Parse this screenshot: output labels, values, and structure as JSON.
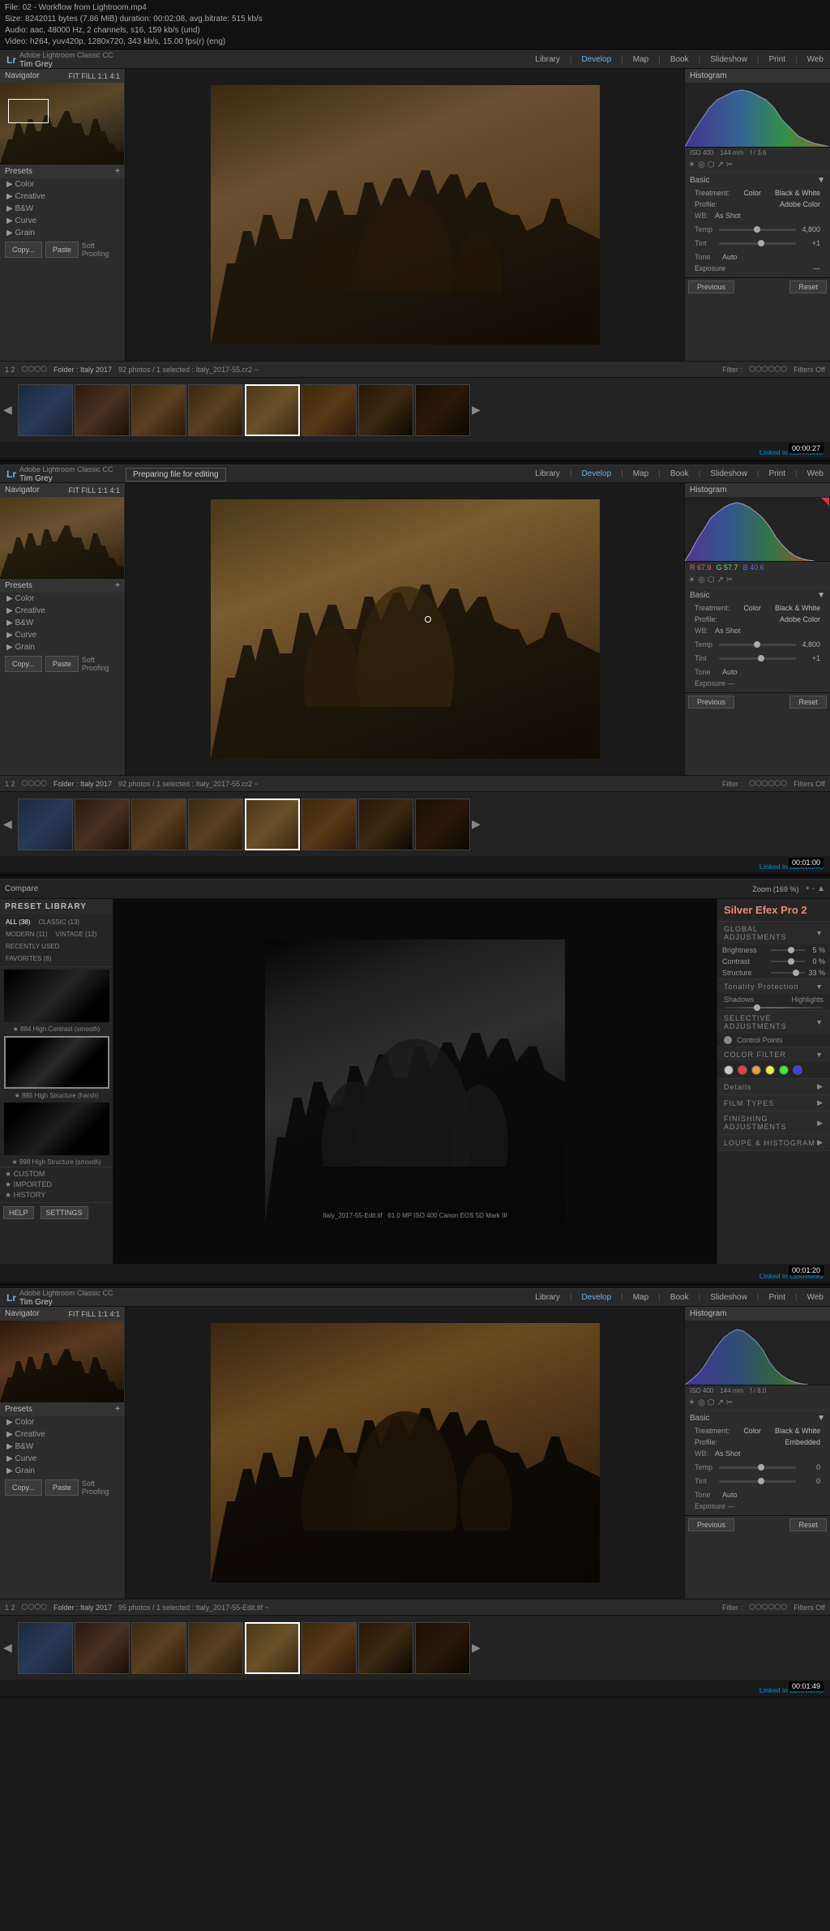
{
  "video": {
    "filename": "File: 02 - Workflow from Lightroom.mp4",
    "size": "Size: 8242011 bytes (7.86 MiB)  duration: 00:02:08, avg.bitrate: 515 kb/s",
    "audio": "Audio: aac, 48000 Hz, 2 channels, s16, 159 kb/s (und)",
    "video_codec": "Video: h264, yuv420p, 1280x720, 343 kb/s, 15.00 fps(r) (eng)"
  },
  "panel1": {
    "brand": "Adobe Lightroom Classic CC",
    "user": "Tim Grey",
    "logo": "Lr",
    "nav": {
      "library": "Library",
      "develop": "Develop",
      "map": "Map",
      "book": "Book",
      "slideshow": "Slideshow",
      "print": "Print",
      "web": "Web"
    },
    "navigator": {
      "title": "Navigator",
      "controls": "FIT  FILL  1:1  4:1"
    },
    "presets": {
      "title": "Presets",
      "items": [
        "▶ Color",
        "▶ Creative",
        "▶ B&W",
        "▶ Curve",
        "▶ Grain"
      ]
    },
    "histogram_label": "Histogram",
    "basic_label": "Basic",
    "treatment_label": "Treatment:",
    "treatment_color": "Color",
    "treatment_bw": "Black & White",
    "profile_label": "Profile:",
    "profile_value": "Adobe Color",
    "wb_label": "WB:",
    "wb_value": "As Shot",
    "temp_label": "Temp",
    "temp_value": "4,800",
    "tint_label": "Tint",
    "tint_value": "+1",
    "tone_label": "Tone",
    "tone_value": "Auto",
    "previous_btn": "Previous",
    "reset_btn": "Reset",
    "copy_btn": "Copy...",
    "paste_btn": "Paste",
    "softproof": "Soft Proofing",
    "folder": "Folder : Italy 2017",
    "photos_count": "92 photos / 1 selected : Italy_2017-55.cr2 ~",
    "filter_label": "Filter :",
    "filters_off": "Filters Off",
    "timestamp": "00:00:27",
    "linkedin": "Linked in LEARNING"
  },
  "panel2": {
    "preparing_text": "Preparing file for editing",
    "brand": "Adobe Lightroom Classic CC",
    "user": "Tim Grey",
    "logo": "Lr",
    "nav": {
      "library": "Library",
      "develop": "Develop",
      "map": "Map",
      "book": "Book",
      "slideshow": "Slideshow",
      "print": "Print",
      "web": "Web"
    },
    "navigator_title": "Navigator",
    "navigator_controls": "FIT  FILL  1:1  4:1",
    "presets_title": "Presets",
    "presets_items": [
      "▶ Color",
      "▶ Creative",
      "▶ B&W",
      "▶ Curve",
      "▶ Grain"
    ],
    "histogram_label": "Histogram",
    "rgb": {
      "r": "R 67.9",
      "g": "G 57.7",
      "b": "B 40.6"
    },
    "basic_label": "Basic",
    "treatment_label": "Treatment:",
    "treatment_color": "Color",
    "treatment_bw": "Black & White",
    "profile_label": "Profile:",
    "profile_value": "Adobe Color",
    "wb_label": "WB:",
    "wb_value": "As Shot",
    "temp_label": "Temp",
    "temp_value": "4,800",
    "tint_label": "Tint",
    "tint_value": "+1",
    "tone_label": "Tone",
    "tone_value": "Auto",
    "exposure_label": "Exposure",
    "previous_btn": "Previous",
    "reset_btn": "Reset",
    "copy_btn": "Copy...",
    "paste_btn": "Paste",
    "softproof": "Soft Proofing",
    "folder": "Folder : Italy 2017",
    "photos_count": "92 photos / 1 selected : Italy_2017-55.cr2 ~",
    "filter_label": "Filter :",
    "filters_off": "Filters Off",
    "timestamp": "00:01:00",
    "linkedin": "Linked in LEARNING"
  },
  "panel3": {
    "lib_title": "PRESET LIBRARY",
    "tabs": [
      "ALL (38)",
      "CLASSIC (13)",
      "MODERN (11)",
      "VINTAGE (12)",
      "RECENTLY USED",
      "FAVORITES (8)"
    ],
    "presets": [
      {
        "label": "★ 884 High Contrast (smooth)"
      },
      {
        "label": "★ 885 High Structure (harsh)"
      },
      {
        "label": "★ 998 High Structure (smooth)"
      }
    ],
    "custom_label": "★ CUSTOM",
    "imported_label": "★ IMPORTED",
    "history_label": "★ HISTORY",
    "help_btn": "HELP",
    "settings_btn": "SETTINGS",
    "toolbar": {
      "compare_btn": "Compare",
      "zoom_label": "Zoom (169 %)"
    },
    "plugin_title": "Silver Efex Pro",
    "plugin_version": "2",
    "global_adjustments": "GLOBAL ADJUSTMENTS",
    "brightness_label": "Brightness",
    "brightness_value": "5 %",
    "contrast_label": "Contrast",
    "contrast_value": "0 %",
    "structure_label": "Structure",
    "structure_value": "33 %",
    "tonality_label": "Tonality Protection",
    "shadows_label": "Shadows",
    "highlights_label": "Highlights",
    "selective_label": "SELECTIVE ADJUSTMENTS",
    "control_points_label": "Control Points",
    "color_filter_label": "COLOR FILTER",
    "details_label": "Details",
    "film_types_label": "FILM TYPES",
    "finishing_label": "FINISHING ADJUSTMENTS",
    "loupe_label": "LOUPE & HISTOGRAM",
    "image_label": "Italy_2017-55-Edit.tif",
    "image_meta": "61.0 MP  ISO 400  Canon EOS 5D Mark III",
    "timestamp": "00:01:20",
    "linkedin": "Linked in LEARNING"
  },
  "panel4": {
    "brand": "Adobe Lightroom Classic CC",
    "user": "Tim Grey",
    "logo": "Lr",
    "nav": {
      "library": "Library",
      "develop": "Develop",
      "map": "Map",
      "book": "Book",
      "slideshow": "Slideshow",
      "print": "Print",
      "web": "Web"
    },
    "navigator_title": "Navigator",
    "navigator_controls": "FIT  FILL  1:1  4:1",
    "presets_title": "Presets",
    "presets_items": [
      "▶ Color",
      "▶ Creative",
      "▶ B&W",
      "▶ Curve",
      "▶ Grain"
    ],
    "histogram_label": "Histogram",
    "basic_label": "Basic",
    "treatment_label": "Treatment:",
    "treatment_color": "Color",
    "treatment_bw": "Black & White",
    "profile_label": "Profile:",
    "profile_value": "Embedded",
    "wb_label": "WB:",
    "wb_value": "As Shot",
    "temp_label": "Temp",
    "temp_value": "0",
    "tint_label": "Tint",
    "tint_value": "0",
    "tone_label": "Tone",
    "tone_value": "Auto",
    "previous_btn": "Previous",
    "reset_btn": "Reset",
    "copy_btn": "Copy...",
    "paste_btn": "Paste",
    "softproof": "Soft Proofing",
    "folder": "Folder : Italy 2017",
    "photos_count": "95 photos / 1 selected : Italy_2017-55-Edit.tif ~",
    "filter_label": "Filter :",
    "filters_off": "Filters Off",
    "cam_info": {
      "iso": "ISO 400",
      "focal": "144 mm",
      "aperture": "f / 8.0"
    },
    "timestamp": "00:01:49",
    "linkedin": "Linked in LEARNING"
  },
  "colors": {
    "active_tab": "#6ab4e8",
    "bg_dark": "#1a1a1a",
    "bg_medium": "#2c2c2c",
    "bg_light": "#3a3a3a",
    "border": "#444",
    "text_primary": "#ccc",
    "text_secondary": "#888",
    "accent_blue": "#6ab4e8",
    "accent_orange": "#c87840",
    "color_dots": [
      "#c8c8c8",
      "#e84040",
      "#e8a040",
      "#e8e840",
      "#40e840",
      "#4040e8"
    ]
  }
}
